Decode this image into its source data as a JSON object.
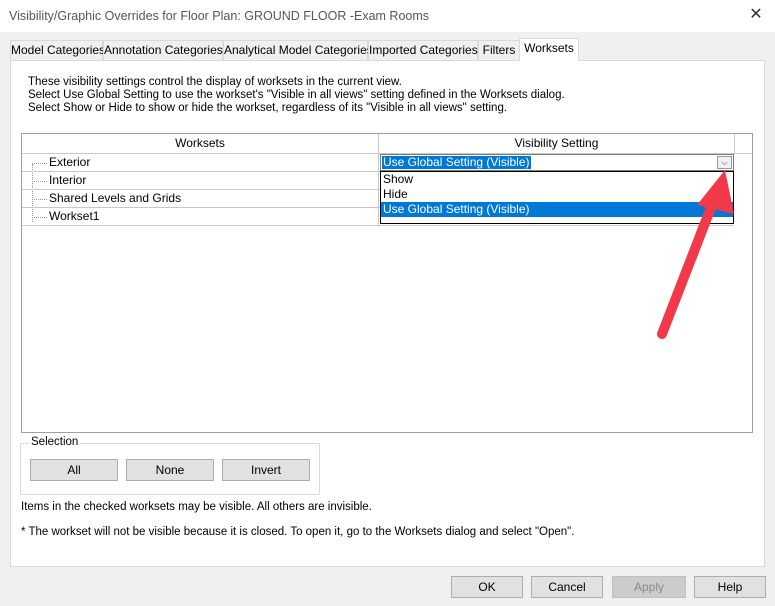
{
  "window": {
    "title": "Visibility/Graphic Overrides for Floor Plan: GROUND FLOOR -Exam Rooms",
    "close_glyph": "✕"
  },
  "tabs": [
    {
      "label": "Model Categories",
      "active": false
    },
    {
      "label": "Annotation Categories",
      "active": false
    },
    {
      "label": "Analytical Model Categories",
      "active": false
    },
    {
      "label": "Imported Categories",
      "active": false
    },
    {
      "label": "Filters",
      "active": false
    },
    {
      "label": "Worksets",
      "active": true
    }
  ],
  "description": [
    "These visibility settings control the display of worksets in the current view.",
    "Select Use Global Setting to use the workset's \"Visible in all views\" setting defined in the Worksets dialog.",
    "Select Show or Hide to show or hide the workset, regardless of its \"Visible in all views\" setting."
  ],
  "grid": {
    "headers": [
      "Worksets",
      "Visibility Setting"
    ],
    "rows": [
      {
        "name": "Exterior",
        "setting": "Use Global Setting (Visible)"
      },
      {
        "name": "Interior",
        "setting": ""
      },
      {
        "name": "Shared Levels and Grids",
        "setting": ""
      },
      {
        "name": "Workset1",
        "setting": ""
      }
    ],
    "dropdown": {
      "selected": "Use Global Setting (Visible)",
      "options": [
        "Show",
        "Hide",
        "Use Global Setting (Visible)"
      ],
      "highlighted_index": 2
    }
  },
  "selection": {
    "label": "Selection",
    "buttons": [
      "All",
      "None",
      "Invert"
    ]
  },
  "notes": [
    "Items in the checked worksets may be visible.  All others are invisible.",
    "* The workset will not be visible because it is closed. To open it, go to the Worksets dialog and select \"Open\"."
  ],
  "footer_buttons": {
    "ok": "OK",
    "cancel": "Cancel",
    "apply": "Apply",
    "help": "Help"
  },
  "annotation": {
    "arrow_color": "#f2394a"
  }
}
